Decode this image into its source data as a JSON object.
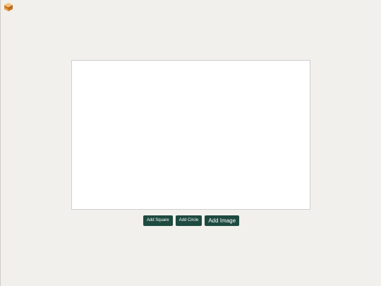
{
  "app": {
    "logo_icon": "sandwich-box-icon"
  },
  "canvas": {
    "background": "#ffffff"
  },
  "toolbar": {
    "add_square_label": "Add Square",
    "add_circle_label": "Add Circle",
    "add_image_label": "Add Image"
  },
  "colors": {
    "page_background": "#f2f0ec",
    "button_background": "#1e4a3f",
    "logo_orange": "#e89a3a"
  }
}
